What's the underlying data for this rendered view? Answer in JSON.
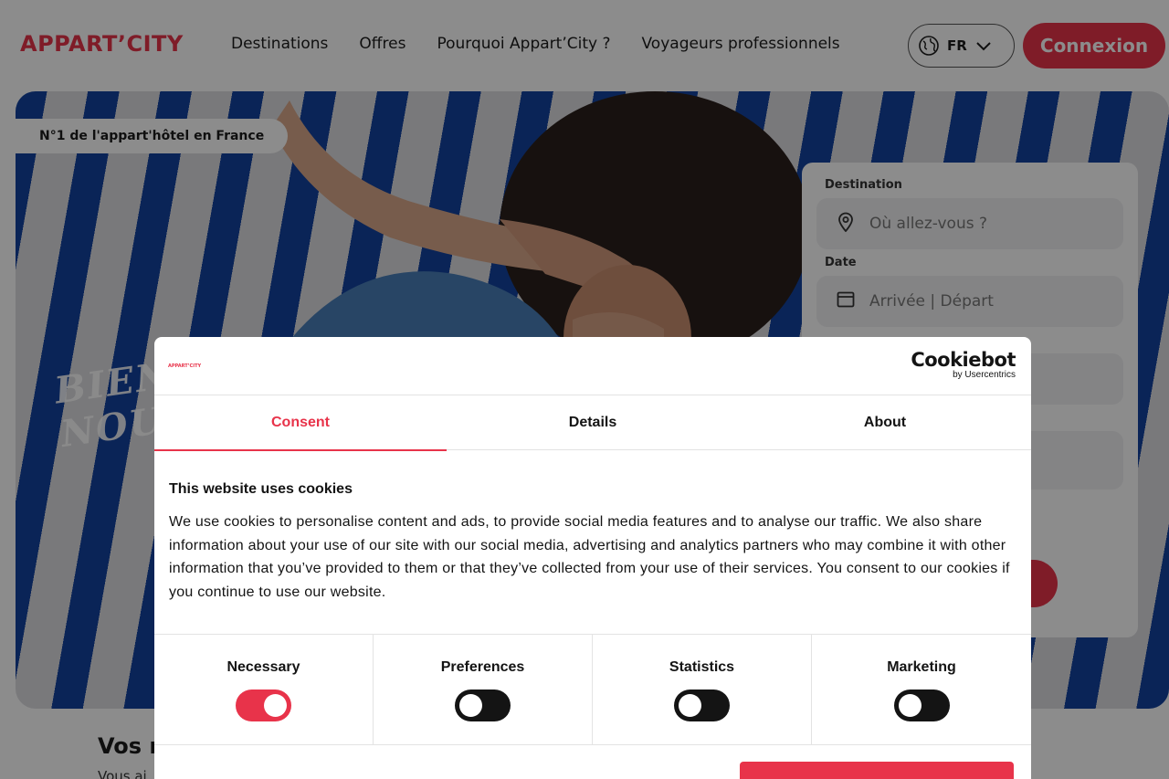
{
  "header": {
    "logo": "APPART’CITY",
    "nav": [
      "Destinations",
      "Offres",
      "Pourquoi Appart’City ?",
      "Voyageurs professionnels"
    ],
    "language": "FR",
    "login_label": "Connexion"
  },
  "hero": {
    "badge": "N°1 de l'appart'hôtel en France",
    "headline_line1": "BIEN",
    "headline_line2": "NOUV"
  },
  "booking": {
    "destination_label": "Destination",
    "destination_placeholder": "Où allez-vous ?",
    "date_label": "Date",
    "date_placeholder": "Arrivée | Départ"
  },
  "section": {
    "title": "Vos r",
    "subtitle": "Vous ai"
  },
  "cookie_dialog": {
    "logo": "APPART’CITY",
    "brand": "Cookiebot",
    "brand_sub": "by Usercentrics",
    "tabs": [
      "Consent",
      "Details",
      "About"
    ],
    "active_tab": "Consent",
    "title": "This website uses cookies",
    "text": "We use cookies to personalise content and ads, to provide social media features and to analyse our traffic. We also share information about your use of our site with our social media, advertising and analytics partners who may combine it with other information that you’ve provided to them or that they’ve collected from your use of their services. You consent to our cookies if you continue to use our website.",
    "categories": [
      {
        "label": "Necessary",
        "enabled": true
      },
      {
        "label": "Preferences",
        "enabled": false
      },
      {
        "label": "Statistics",
        "enabled": false
      },
      {
        "label": "Marketing",
        "enabled": false
      }
    ]
  },
  "colors": {
    "brand": "#e8334a",
    "stripe_blue": "#1547a8",
    "toggle_off": "#141414"
  }
}
